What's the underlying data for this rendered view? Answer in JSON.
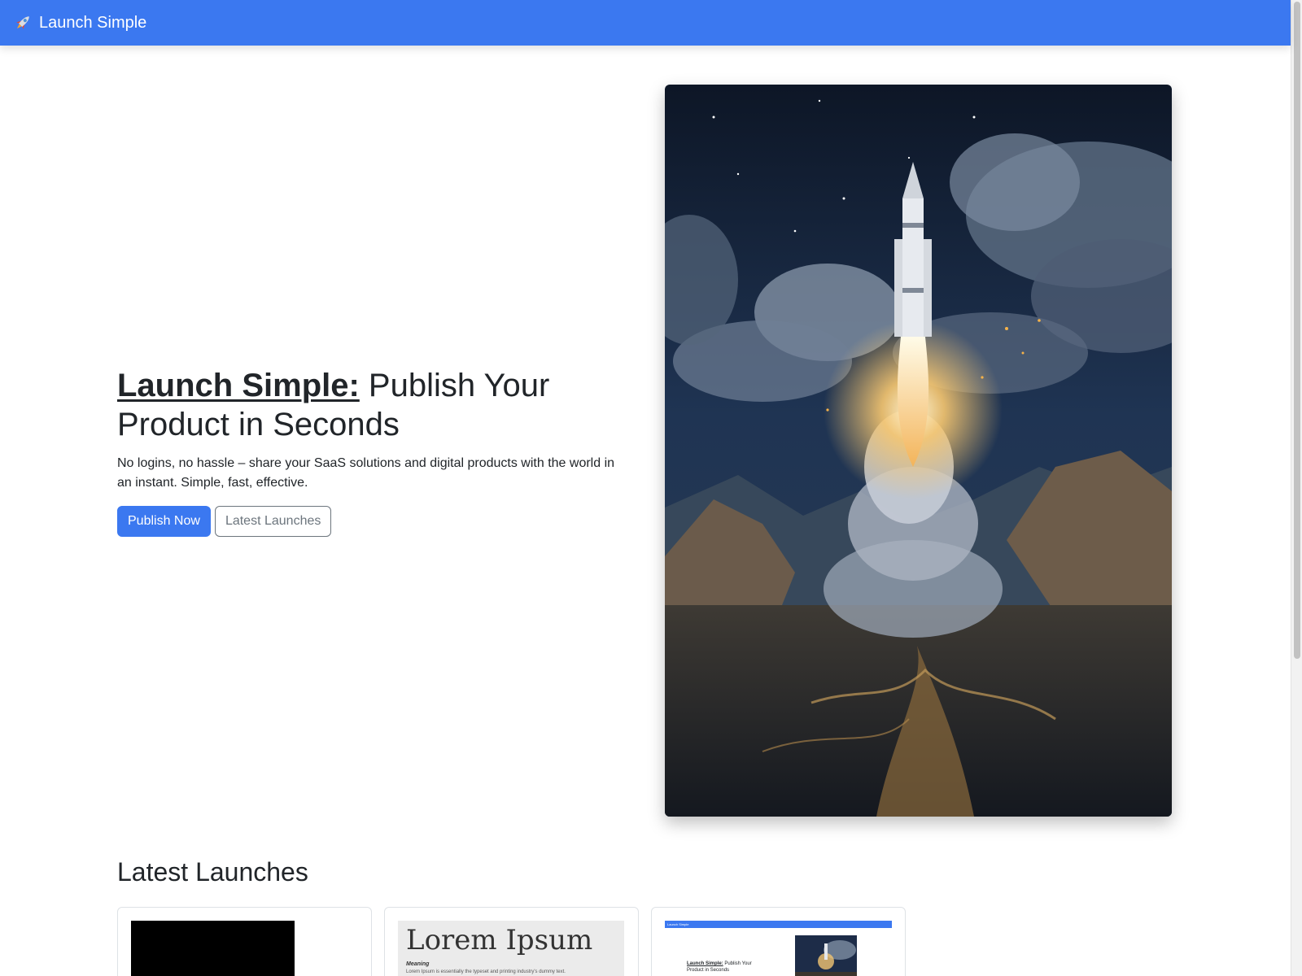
{
  "navbar": {
    "brand_label": "Launch Simple",
    "brand_icon": "rocket-icon",
    "color": "#3b78f0"
  },
  "hero": {
    "title_brand": "Launch Simple:",
    "title_rest": " Publish Your Product in Seconds",
    "subtitle": "No logins, no hassle – share your SaaS solutions and digital products with the world in an instant. Simple, fast, effective.",
    "primary_button": "Publish Now",
    "secondary_button": "Latest Launches",
    "image": "rocket-launch-illustration"
  },
  "latest": {
    "title": "Latest Launches",
    "cards": [
      {
        "thumbnail": "black-screenshot"
      },
      {
        "thumbnail": "lorem-ipsum-screenshot",
        "thumb_title": "Lorem Ipsum",
        "thumb_heading": "Meaning",
        "thumb_text": "Lorem Ipsum is essentially the typeset and printing industry's dummy text."
      },
      {
        "thumbnail": "launch-simple-screenshot",
        "thumb_nav": "Launch Simple",
        "thumb_title_brand": "Launch Simple:",
        "thumb_title_rest": " Publish Your Product in Seconds"
      }
    ]
  },
  "colors": {
    "primary": "#3b78f0",
    "text": "#212529",
    "muted": "#6c757d"
  }
}
